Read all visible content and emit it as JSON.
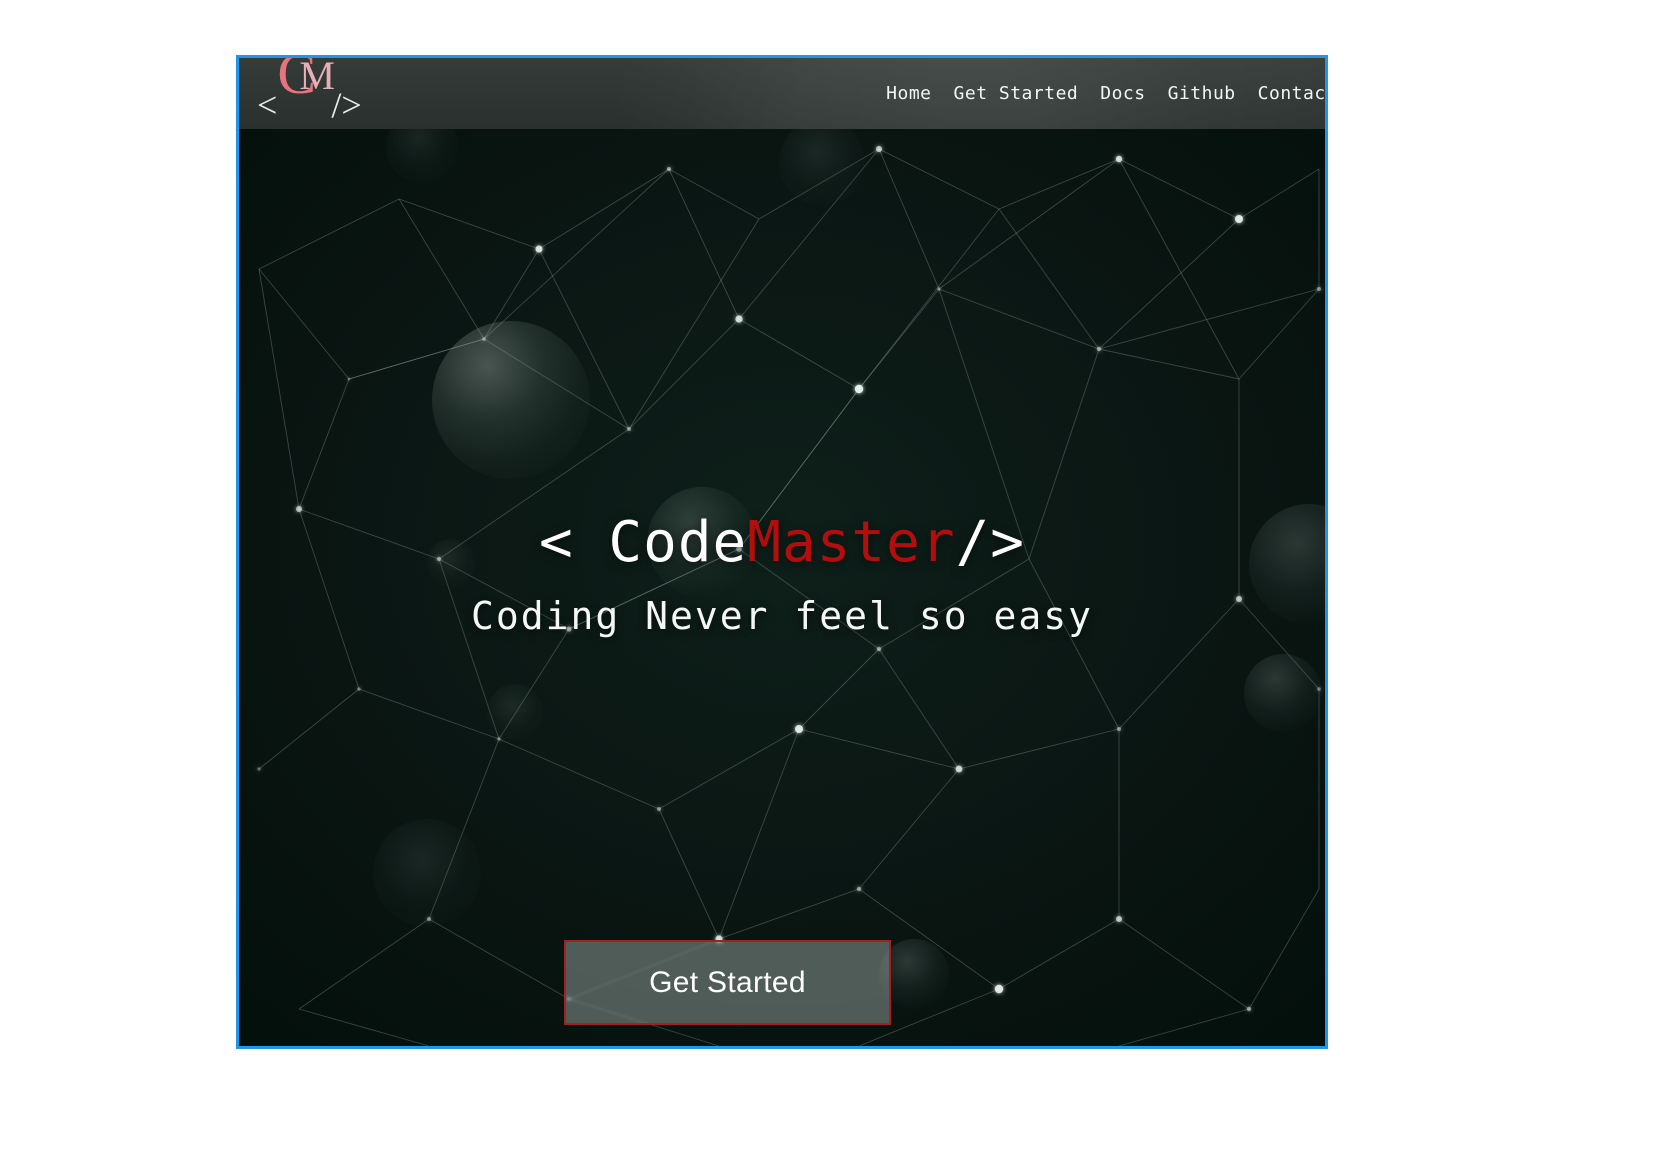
{
  "site": {
    "logo": {
      "open_angle": "<",
      "letter_c": "C",
      "letter_m": "M",
      "slash_close": "/>",
      "full_text": "<CM/>",
      "accent_color": "#e8737e"
    },
    "nav": {
      "items": [
        {
          "label": "Home",
          "name": "nav-link-home"
        },
        {
          "label": "Get Started",
          "name": "nav-link-get-started"
        },
        {
          "label": "Docs",
          "name": "nav-link-docs"
        },
        {
          "label": "Github",
          "name": "nav-link-github"
        },
        {
          "label": "Contact",
          "name": "nav-link-contact"
        }
      ],
      "background_color": "#2e3532",
      "text_color": "#f2f5f4"
    }
  },
  "hero": {
    "title": {
      "prefix": "< Code",
      "accent": "Master",
      "suffix": "/>",
      "full_text": "< CodeMaster/>",
      "accent_color": "#b30d0d",
      "text_color": "#ffffff"
    },
    "subtitle": "Coding Never feel so easy",
    "cta": {
      "label": "Get Started",
      "border_color": "#a8201e",
      "fill_color": "rgba(150,163,158,0.50)",
      "text_color": "#ffffff"
    },
    "background": {
      "description": "dark green network / constellation particle graphic with bokeh spheres",
      "base_color": "#091310",
      "line_color": "#9fb3ad"
    }
  },
  "frame": {
    "border_color": "#2196e8",
    "page_background": "#ffffff"
  }
}
